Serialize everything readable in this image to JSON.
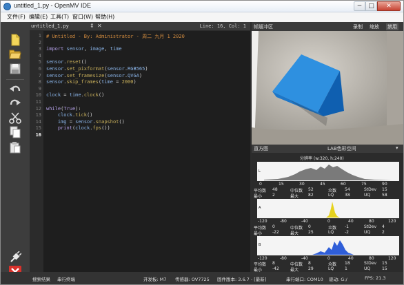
{
  "window": {
    "title": "untitled_1.py - OpenMV IDE",
    "min_label": "─",
    "max_label": "□",
    "close_label": "✕"
  },
  "menu": [
    "文件(F)",
    "编辑(E)",
    "工具(T)",
    "窗口(W)",
    "帮助(H)"
  ],
  "toolbar_icons": [
    "new-file-icon",
    "open-folder-icon",
    "save-icon",
    "undo-icon",
    "redo-icon",
    "cut-icon",
    "copy-icon",
    "paste-icon",
    "connect-icon",
    "run-stop-icon"
  ],
  "editor": {
    "tab_label": "untitled_1.py",
    "tab_arrows": "⇕",
    "tab_close": "✕",
    "cursor_info": "Line: 16, Col: 1",
    "line_numbers": [
      "1",
      "2",
      "3",
      "4",
      "5",
      "6",
      "7",
      "8",
      "9",
      "10",
      "11",
      "12",
      "13",
      "14",
      "15",
      "16"
    ],
    "current_line": "16"
  },
  "framebuffer": {
    "title": "帧缓冲区",
    "record": "录制",
    "zoom": "缩放",
    "disable": "禁用"
  },
  "histogram": {
    "title": "直方图",
    "color_space": "LAB色彩空间",
    "resolution": "分辨率 (w:320, h:240)",
    "l_ticks": [
      "0",
      "15",
      "30",
      "45",
      "60",
      "75",
      "90"
    ],
    "ab_ticks": [
      "-120",
      "-80",
      "-40",
      "0",
      "40",
      "80",
      "120"
    ],
    "channel_labels": [
      "L",
      "A",
      "B"
    ],
    "stats": [
      {
        "row1": {
          "mean_label": "平均数",
          "mean": "48",
          "median_label": "中位数",
          "median": "52",
          "mode_label": "众数",
          "mode": "54",
          "stdev_label": "StDev",
          "stdev": "15"
        },
        "row2": {
          "min_label": "最小",
          "min": "2",
          "max_label": "最大",
          "max": "82",
          "lq_label": "LQ",
          "lq": "38",
          "uq_label": "UQ",
          "uq": "58"
        }
      },
      {
        "row1": {
          "mean_label": "平均数",
          "mean": "0",
          "median_label": "中位数",
          "median": "0",
          "mode_label": "众数",
          "mode": "-1",
          "stdev_label": "StDev",
          "stdev": "4"
        },
        "row2": {
          "min_label": "最小",
          "min": "-22",
          "max_label": "最大",
          "max": "25",
          "lq_label": "LQ",
          "lq": "-2",
          "uq_label": "UQ",
          "uq": "2"
        }
      },
      {
        "row1": {
          "mean_label": "平均数",
          "mean": "8",
          "median_label": "中位数",
          "median": "8",
          "mode_label": "众数",
          "mode": "18",
          "stdev_label": "StDev",
          "stdev": "15"
        },
        "row2": {
          "min_label": "最小",
          "min": "-42",
          "max_label": "最大",
          "max": "29",
          "lq_label": "LQ",
          "lq": "1",
          "uq_label": "UQ",
          "uq": "15"
        }
      }
    ]
  },
  "statusbar": {
    "search_results": "搜索结果",
    "serial_terminal": "串行终端",
    "board": "开发板: M7",
    "sensor": "传感器: OV7725",
    "firmware": "固件版本: 3.6.7 - [最新]",
    "serial_port": "串行端口: COM10",
    "drive": "驱动: G:/",
    "fps": "FPS: 21.3"
  },
  "colors": {
    "editor_bg": "#1e1e1e",
    "toolbar_bg": "#3d3d3d",
    "comment": "#d08a3e",
    "keyword": "#b4a0e8",
    "cube_blue": "#1f7fd0"
  }
}
